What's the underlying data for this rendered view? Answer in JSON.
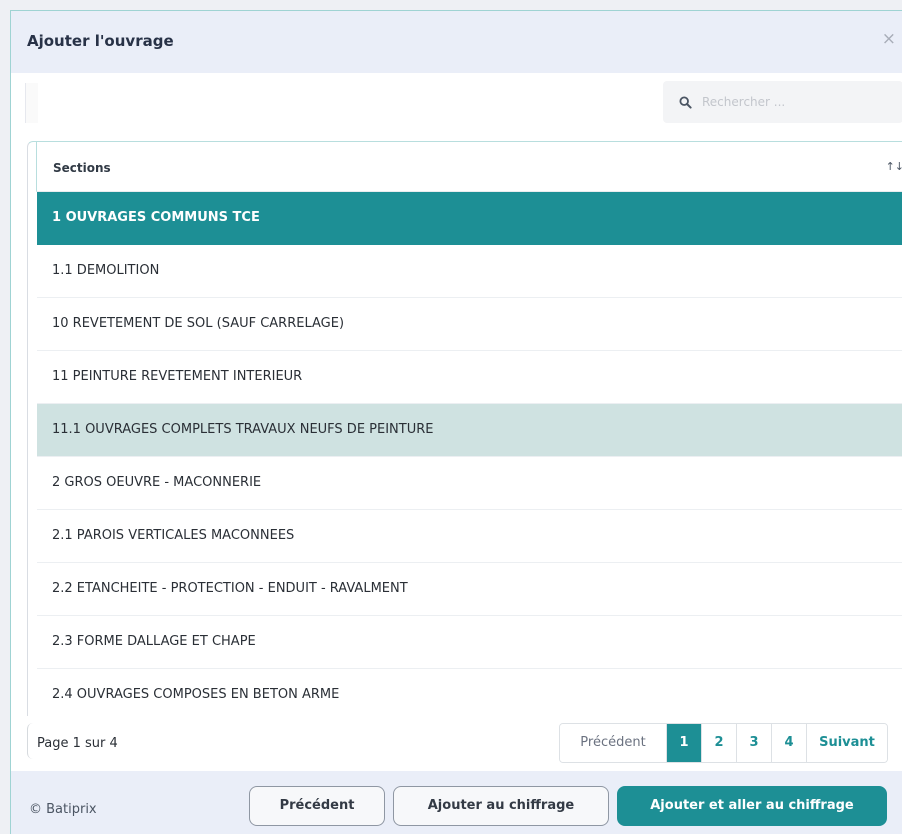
{
  "modal": {
    "title": "Ajouter l'ouvrage",
    "close": "×"
  },
  "search": {
    "placeholder": "Rechercher ..."
  },
  "table": {
    "column_header": "Sections",
    "sort_glyph": "↑↓",
    "rows": [
      "1 OUVRAGES COMMUNS TCE",
      "1.1 DEMOLITION",
      "10 REVETEMENT DE SOL (SAUF CARRELAGE)",
      "11 PEINTURE REVETEMENT INTERIEUR",
      "11.1 OUVRAGES COMPLETS TRAVAUX NEUFS DE PEINTURE",
      "2 GROS OEUVRE - MACONNERIE",
      "2.1 PAROIS VERTICALES MACONNEES",
      "2.2 ETANCHEITE - PROTECTION - ENDUIT - RAVALMENT",
      "2.3 FORME DALLAGE ET CHAPE",
      "2.4 OUVRAGES COMPOSES EN BETON ARME"
    ]
  },
  "pager": {
    "info": "Page 1 sur 4",
    "previous": "Précédent",
    "pages": [
      "1",
      "2",
      "3",
      "4"
    ],
    "next": "Suivant"
  },
  "footer": {
    "copyright": "© Batiprix",
    "prev_button": "Précédent",
    "add_button": "Ajouter au chiffrage",
    "add_go_button": "Ajouter et aller au chiffrage"
  },
  "colors": {
    "accent": "#1d8f95",
    "hover_row": "#cfe2e1",
    "header_bg": "#eaeef8"
  },
  "icons": {
    "search": "search-icon",
    "close": "close-icon",
    "sort": "sort-icon"
  }
}
